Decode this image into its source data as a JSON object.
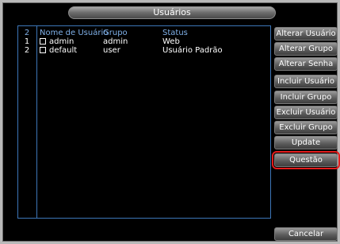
{
  "window": {
    "title": "Usuários"
  },
  "table": {
    "count": "2",
    "headers": {
      "name": "Nome de Usuário",
      "group": "Grupo",
      "status": "Status"
    },
    "rows": [
      {
        "index": "1",
        "name": "admin",
        "group": "admin",
        "status": "Web"
      },
      {
        "index": "2",
        "name": "default",
        "group": "user",
        "status": "Usuário Padrão"
      }
    ]
  },
  "buttons": {
    "alter_user": "Alterar Usuário",
    "alter_group": "Alterar Grupo",
    "alter_password": "Alterar Senha",
    "add_user": "Incluir Usuário",
    "add_group": "Incluir Grupo",
    "delete_user": "Excluir Usuário",
    "delete_group": "Excluir Grupo",
    "update": "Update",
    "question": "Questão",
    "cancel": "Cancelar"
  },
  "colors": {
    "focus": "#e21b1b",
    "accent": "#3d76b8"
  }
}
